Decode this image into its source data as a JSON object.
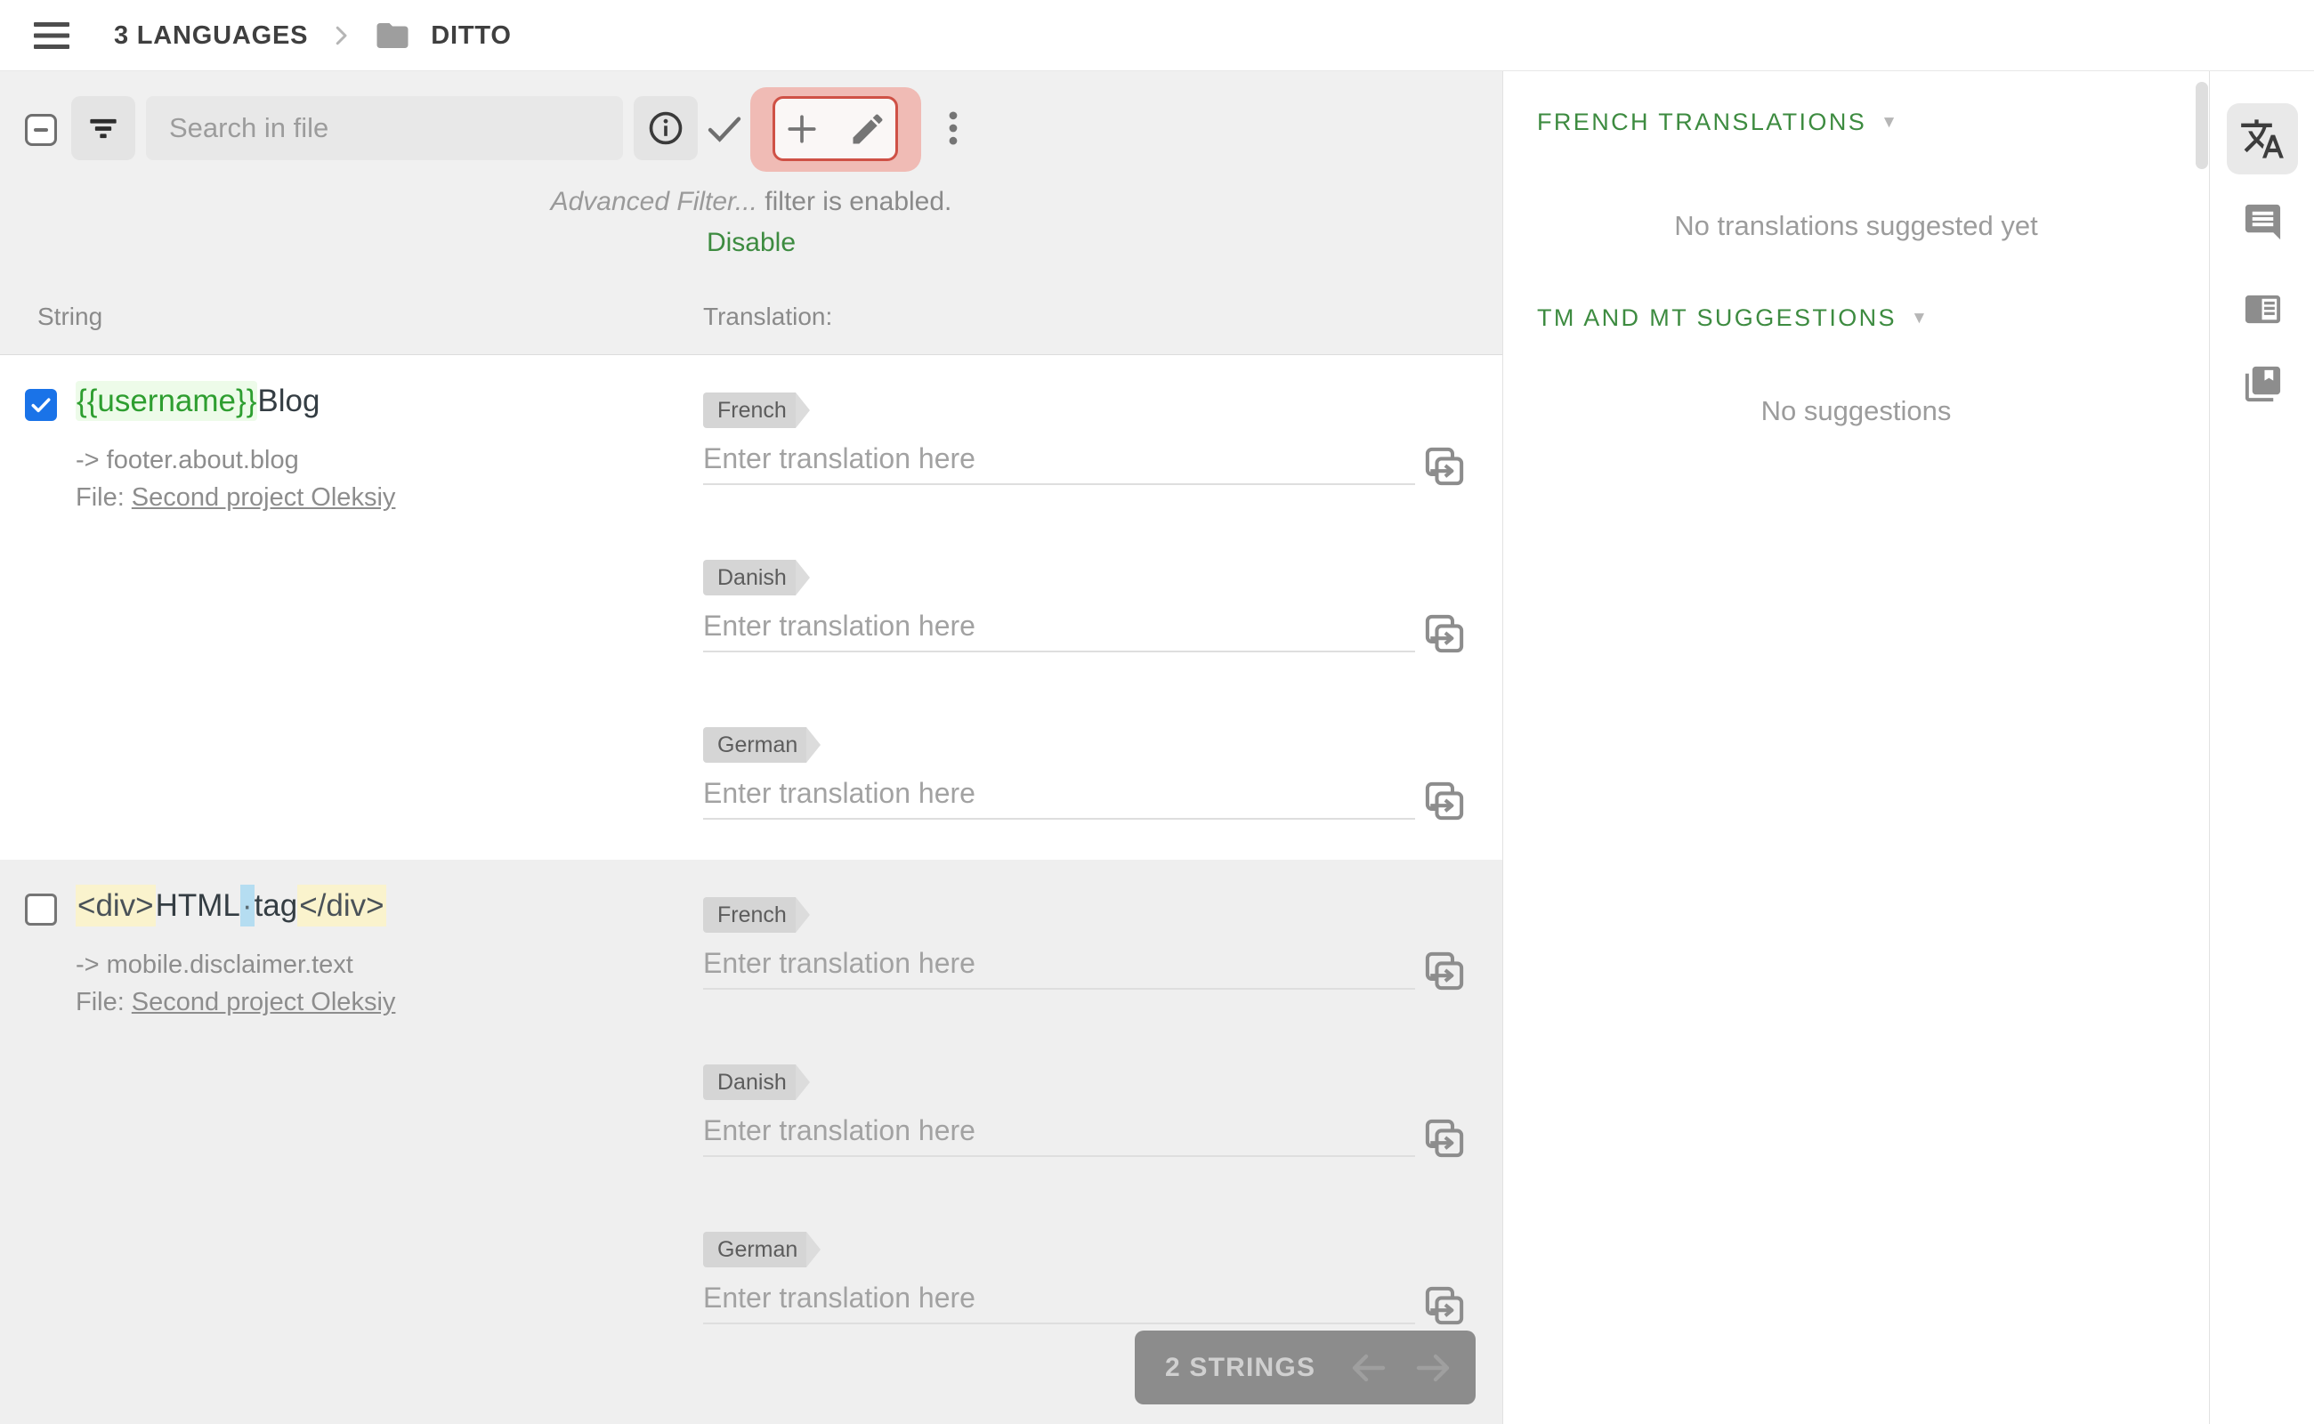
{
  "topbar": {
    "breadcrumb_root": "3 LANGUAGES",
    "breadcrumb_folder": "DITTO"
  },
  "toolbar": {
    "search_placeholder": "Search in file"
  },
  "filter_notice": {
    "filter_name": "Advanced Filter...",
    "message": " filter is enabled.",
    "action_label": "Disable"
  },
  "table_header": {
    "string_col": "String",
    "translation_col": "Translation:"
  },
  "rows": [
    {
      "selected": true,
      "string_parts": [
        {
          "type": "variable",
          "text": "{{username}}"
        },
        {
          "type": "plain",
          "text": "Blog"
        }
      ],
      "key_path": "-> footer.about.blog",
      "file_label": "File:",
      "file_link": "Second project Oleksiy",
      "translations": [
        {
          "lang": "French",
          "value": "",
          "placeholder": "Enter translation here"
        },
        {
          "lang": "Danish",
          "value": "",
          "placeholder": "Enter translation here"
        },
        {
          "lang": "German",
          "value": "",
          "placeholder": "Enter translation here"
        }
      ]
    },
    {
      "selected": false,
      "string_parts": [
        {
          "type": "html-tag",
          "text": "<div>"
        },
        {
          "type": "plain",
          "text": "HTML"
        },
        {
          "type": "space-marker",
          "text": "·"
        },
        {
          "type": "plain",
          "text": "tag"
        },
        {
          "type": "html-tag",
          "text": "</div>"
        }
      ],
      "key_path": "-> mobile.disclaimer.text",
      "file_label": "File:",
      "file_link": "Second project Oleksiy",
      "translations": [
        {
          "lang": "French",
          "value": "",
          "placeholder": "Enter translation here"
        },
        {
          "lang": "Danish",
          "value": "",
          "placeholder": "Enter translation here"
        },
        {
          "lang": "German",
          "value": "",
          "placeholder": "Enter translation here"
        }
      ]
    }
  ],
  "pagination": {
    "count_label": "2 STRINGS"
  },
  "right_panel": {
    "sections": [
      {
        "title": "FRENCH TRANSLATIONS",
        "caret": "▼",
        "empty_text": "No translations suggested yet"
      },
      {
        "title": "TM AND MT SUGGESTIONS",
        "caret": "▼",
        "empty_text": "No suggestions"
      }
    ]
  },
  "colors": {
    "accent_green": "#3d8b40",
    "selection_blue": "#1a73e8",
    "highlight_red_border": "#cf5146",
    "highlight_red_glow": "#f0bbb5",
    "variable_green": "#2e9e30",
    "variable_green_bg": "#edfbe9",
    "html_tag_highlight": "#faf3cd",
    "space_marker_highlight": "#b5ddf1",
    "content_bg": "#f0f0f0"
  }
}
